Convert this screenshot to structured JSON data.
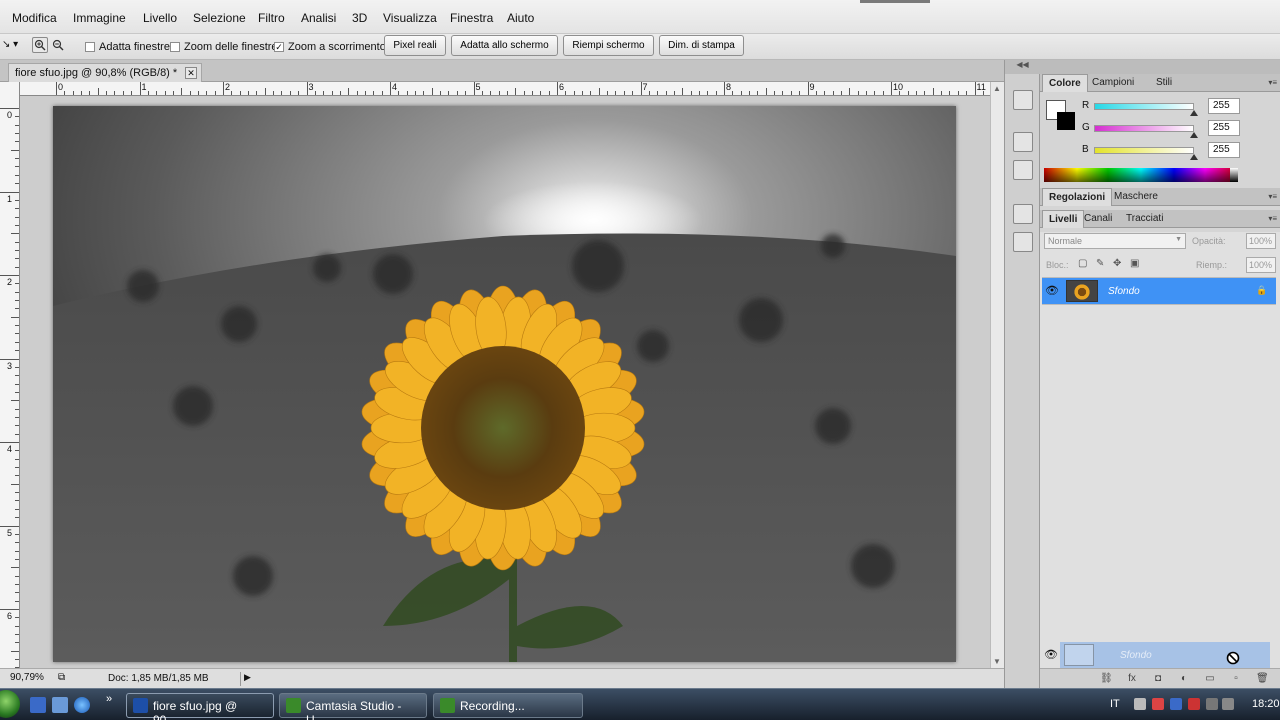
{
  "menu": [
    "Modifica",
    "Immagine",
    "Livello",
    "Selezione",
    "Filtro",
    "Analisi",
    "3D",
    "Visualizza",
    "Finestra",
    "Aiuto"
  ],
  "options": {
    "checks": [
      {
        "label": "Adatta finestre",
        "checked": false
      },
      {
        "label": "Zoom delle finestre",
        "checked": false
      },
      {
        "label": "Zoom a scorrimento",
        "checked": true
      }
    ],
    "buttons": [
      "Pixel reali",
      "Adatta allo schermo",
      "Riempi schermo",
      "Dim. di stampa"
    ]
  },
  "document": {
    "tab_title": "fiore sfuo.jpg @ 90,8% (RGB/8) *",
    "ruler_top": [
      "0",
      "1",
      "2",
      "3",
      "4",
      "5",
      "6",
      "7",
      "8",
      "9",
      "10",
      "11"
    ],
    "ruler_left": [
      "0",
      "1",
      "2",
      "3",
      "4",
      "5",
      "6"
    ]
  },
  "status": {
    "zoom": "90,79%",
    "doc_info": "Doc: 1,85 MB/1,85 MB"
  },
  "color_panel": {
    "tabs": [
      "Colore",
      "Campioni",
      "Stili"
    ],
    "channels": [
      {
        "label": "R",
        "value": "255",
        "color": "#27d8e6"
      },
      {
        "label": "G",
        "value": "255",
        "color": "#d52fd0"
      },
      {
        "label": "B",
        "value": "255",
        "color": "#e3e32b"
      }
    ]
  },
  "adjust_panel": {
    "tabs": [
      "Regolazioni",
      "Maschere"
    ]
  },
  "layers_panel": {
    "tabs": [
      "Livelli",
      "Canali",
      "Tracciati"
    ],
    "blend_mode": "Normale",
    "opacity_label": "Opacità:",
    "opacity_value": "100%",
    "lock_label": "Bloc.:",
    "fill_label": "Riemp.:",
    "fill_value": "100%",
    "layers": [
      {
        "name": "Sfondo",
        "selected": true
      }
    ],
    "drag_ghost_name": "Sfondo"
  },
  "taskbar": {
    "tasks": [
      {
        "label": "fiore sfuo.jpg @ 90,...",
        "active": true,
        "icon_color": "#1d4fa8"
      },
      {
        "label": "Camtasia Studio - U...",
        "active": false,
        "icon_color": "#3a8a2a"
      },
      {
        "label": "Recording...",
        "active": false,
        "icon_color": "#3a8a2a"
      }
    ],
    "language": "IT",
    "time": "18:20"
  },
  "colors": {
    "selection_blue": "#3f92f5",
    "petal_yellow": "#e9a320"
  }
}
